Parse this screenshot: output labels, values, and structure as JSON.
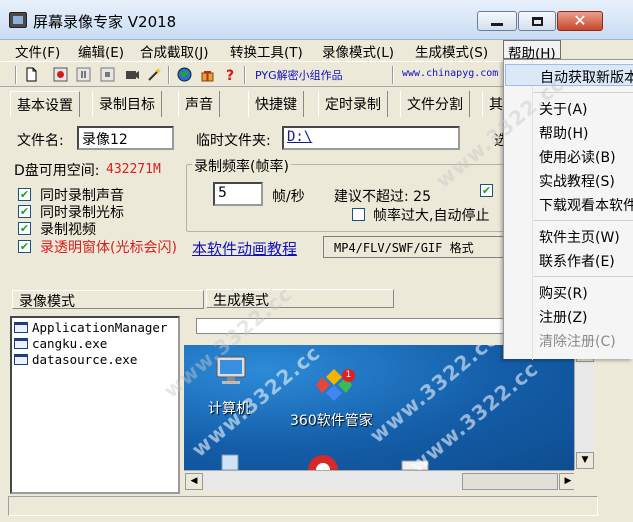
{
  "window": {
    "title": "屏幕录像专家 V2018"
  },
  "menubar": [
    {
      "label": "文件(F)"
    },
    {
      "label": "编辑(E)"
    },
    {
      "label": "合成截取(J)"
    },
    {
      "label": "转换工具(T)"
    },
    {
      "label": "录像模式(L)"
    },
    {
      "label": "生成模式(S)"
    },
    {
      "label": "帮助(H)"
    }
  ],
  "toolbar": {
    "pyg_label": "PYG解密小组作品",
    "url": "www.chinapyg.com"
  },
  "tabs": [
    {
      "label": "基本设置"
    },
    {
      "label": "录制目标"
    },
    {
      "label": "声音"
    },
    {
      "label": "快捷键"
    },
    {
      "label": "定时录制"
    },
    {
      "label": "文件分割"
    },
    {
      "label": "其"
    }
  ],
  "form": {
    "filename_label": "文件名:",
    "filename_value": "录像12",
    "temp_dir_label": "临时文件夹:",
    "temp_dir_value": "D:\\",
    "browse_label": "选",
    "disk_label": "D盘可用空间:",
    "disk_value": "432271M",
    "options": [
      {
        "label": "同时录制声音",
        "checked": true
      },
      {
        "label": "同时录制光标",
        "checked": true
      },
      {
        "label": "录制视频",
        "checked": true
      },
      {
        "label": "录透明窗体(光标会闪)",
        "checked": true,
        "color": "#d81e1e"
      }
    ],
    "fps_group_title": "录制频率(帧率)",
    "fps_value": "5",
    "fps_unit": "帧/秒",
    "fps_suggest": "建议不超过: 25",
    "fps_auto_stop": "帧率过大,自动停止",
    "tutorial_link": "本软件动画教程",
    "format_button": "MP4/FLV/SWF/GIF  格式"
  },
  "panels": {
    "record_mode": "录像模式",
    "generate_mode": "生成模式"
  },
  "processes": [
    "ApplicationManager",
    "cangku.exe",
    "datasource.exe"
  ],
  "preview": {
    "icons": [
      {
        "label": "计算机",
        "icon": "computer-icon"
      },
      {
        "label": "360软件管家",
        "icon": "software-manager-icon"
      }
    ],
    "badge": "1"
  },
  "help_menu": [
    {
      "label": "自动获取新版本",
      "hover": true
    },
    {
      "label": "关于(A)"
    },
    {
      "label": "帮助(H)"
    },
    {
      "label": "使用必读(B)"
    },
    {
      "label": "实战教程(S)"
    },
    {
      "label": "下载观看本软件"
    },
    {
      "label": "软件主页(W)"
    },
    {
      "label": "联系作者(E)"
    },
    {
      "label": "购买(R)"
    },
    {
      "label": "注册(Z)"
    },
    {
      "label": "清除注册(C)",
      "disabled": true
    }
  ],
  "watermark": "www.3322.cc",
  "colors": {
    "accent_red": "#d81e1e",
    "link_blue": "#1010c0",
    "desktop_blue": "#1767b8"
  }
}
